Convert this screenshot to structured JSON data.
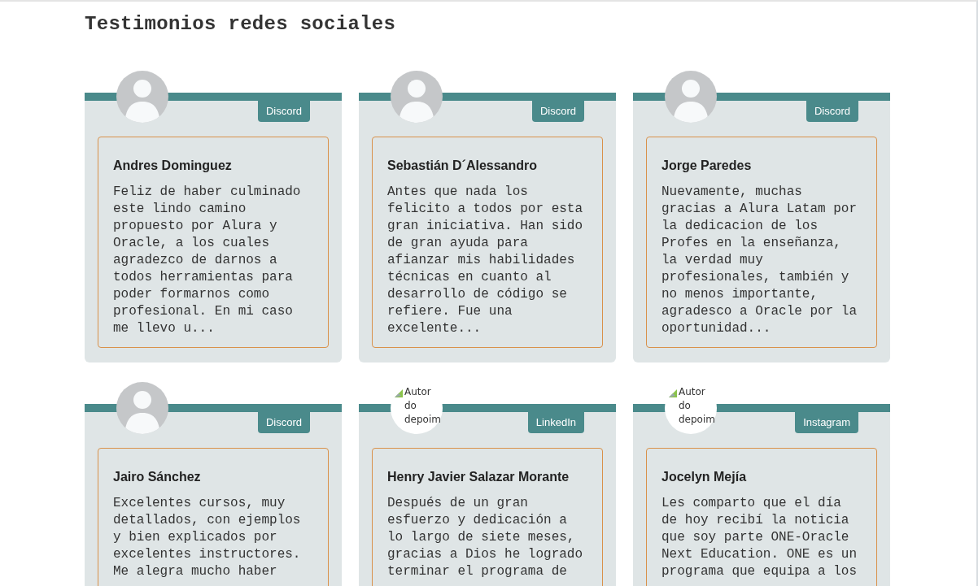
{
  "title": "Testimonios redes sociales",
  "testimonials": [
    {
      "name": "Andres Dominguez",
      "network": "Discord",
      "kind": "silhouette",
      "text": "Feliz de haber culminado este lindo camino propuesto por Alura y Oracle, a los cuales agradezco de darnos a todos herramientas para poder formarnos como profesional. En mi caso me llevo u..."
    },
    {
      "name": "Sebastián D´Alessandro",
      "network": "Discord",
      "kind": "silhouette",
      "text": "Antes que nada los felicito a todos por esta gran iniciativa. Han sido de gran ayuda para afianzar mis habilidades técnicas en cuanto al desarrollo de código se refiere. Fue una excelente..."
    },
    {
      "name": "Jorge Paredes",
      "network": "Discord",
      "kind": "silhouette",
      "text": "Nuevamente, muchas gracias a Alura Latam por la dedicacion de los Profes en la enseñanza, la verdad muy profesionales, también y no menos importante, agradesco a Oracle por la oportunidad..."
    },
    {
      "name": "Jairo Sánchez",
      "network": "Discord",
      "kind": "silhouette",
      "text": "Excelentes cursos, muy detallados, con ejemplos y bien explicados por excelentes instructores. Me alegra mucho haber"
    },
    {
      "name": "Henry Javier Salazar Morante",
      "network": "LinkedIn",
      "kind": "broken",
      "alt": "Autor do depoim",
      "text": "Después de un gran esfuerzo y dedicación a lo largo de siete meses, gracias a Dios he logrado terminar el programa de"
    },
    {
      "name": "Jocelyn Mejía",
      "network": "Instagram",
      "kind": "broken",
      "alt": "Autor do depoim",
      "text": "Les comparto que el día de hoy recibí la noticia que soy parte ONE-Oracle Next Education. ONE es un programa que equipa a los"
    }
  ]
}
